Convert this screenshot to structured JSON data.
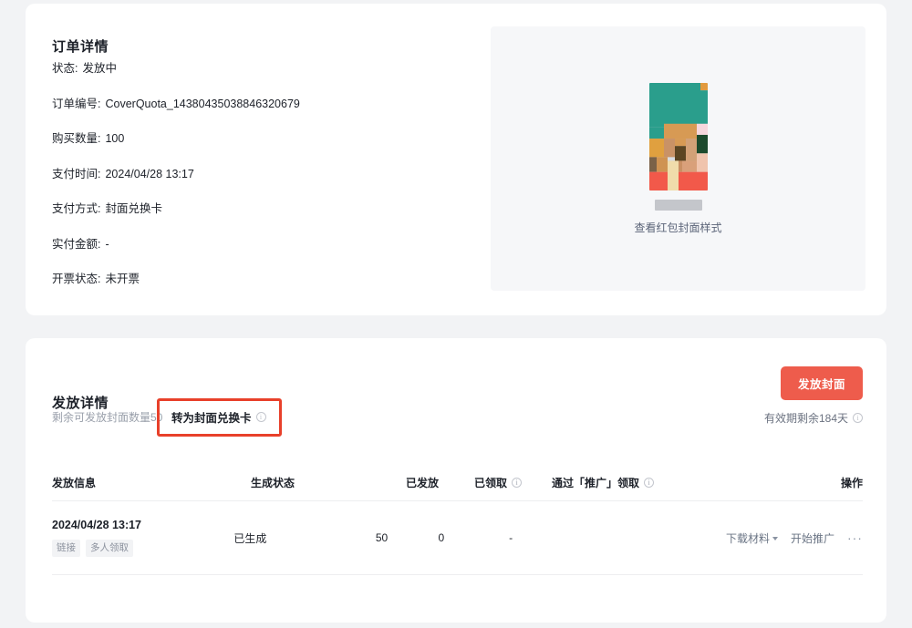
{
  "order": {
    "title": "订单详情",
    "fields": [
      {
        "label": "状态:",
        "value": "发放中"
      },
      {
        "label": "订单编号:",
        "value": "CoverQuota_14380435038846320679"
      },
      {
        "label": "购买数量:",
        "value": "100"
      },
      {
        "label": "支付时间:",
        "value": "2024/04/28 13:17"
      },
      {
        "label": "支付方式:",
        "value": "封面兑换卡"
      },
      {
        "label": "实付金额:",
        "value": "-"
      },
      {
        "label": "开票状态:",
        "value": "未开票"
      }
    ],
    "preview": {
      "link_label": "查看红包封面样式",
      "thumbnail_alt": "cover-thumbnail"
    }
  },
  "grant": {
    "title": "发放详情",
    "remaining_label": "剩余可发放封面数量50",
    "convert_label": "转为封面兑换卡",
    "convert_info_icon": "info-icon",
    "grant_button_label": "发放封面",
    "validity_label": "有效期剩余184天",
    "validity_info_icon": "info-icon",
    "highlight_color": "#e8402a",
    "accent_color": "#ee5c4c",
    "table": {
      "headers": [
        {
          "label": "发放信息",
          "info": false
        },
        {
          "label": "生成状态",
          "info": false
        },
        {
          "label": "已发放",
          "info": false
        },
        {
          "label": "已领取",
          "info": true
        },
        {
          "label": "通过「推广」领取",
          "info": true
        },
        {
          "label": "操作",
          "info": false
        }
      ],
      "rows": [
        {
          "date": "2024/04/28 13:17",
          "tags": [
            "链接",
            "多人领取"
          ],
          "status": "已生成",
          "sent": "50",
          "claimed": "0",
          "promo_claimed": "-",
          "actions": [
            {
              "label": "下载材料",
              "caret": true
            },
            {
              "label": "开始推广",
              "caret": false
            }
          ],
          "more_label": "···"
        }
      ]
    }
  }
}
